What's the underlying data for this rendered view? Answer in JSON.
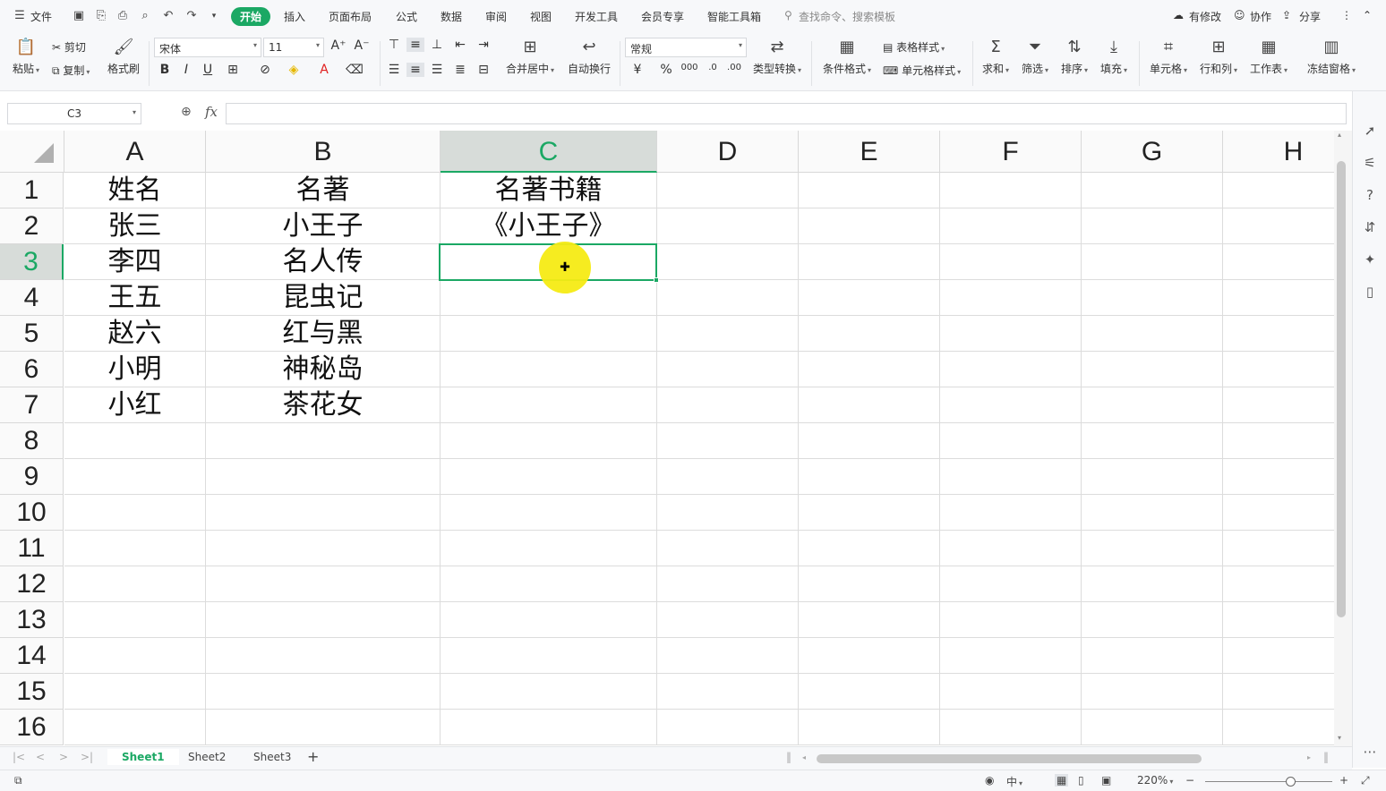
{
  "menubar": {
    "file_label": "文件",
    "tabs": [
      "开始",
      "插入",
      "页面布局",
      "公式",
      "数据",
      "审阅",
      "视图",
      "开发工具",
      "会员专享",
      "智能工具箱"
    ],
    "search_placeholder": "查找命令、搜索模板",
    "modified_label": "有修改",
    "collab_label": "协作",
    "share_label": "分享"
  },
  "ribbon": {
    "paste": "粘贴",
    "cut": "剪切",
    "copy": "复制",
    "format_painter": "格式刷",
    "font_name": "宋体",
    "font_size": "11",
    "merge_center": "合并居中",
    "wrap_text": "自动换行",
    "number_format": "常规",
    "type_convert": "类型转换",
    "conditional_format": "条件格式",
    "table_style": "表格样式",
    "cell_style": "单元格样式",
    "sum": "求和",
    "filter": "筛选",
    "sort": "排序",
    "fill": "填充",
    "cell": "单元格",
    "row_col": "行和列",
    "worksheet": "工作表",
    "freeze": "冻结窗格"
  },
  "formula_bar": {
    "name_box": "C3",
    "fx_label": "fx",
    "formula": ""
  },
  "sheet": {
    "columns": [
      "A",
      "B",
      "C",
      "D",
      "E",
      "F",
      "G",
      "H"
    ],
    "rows": [
      "1",
      "2",
      "3",
      "4",
      "5",
      "6",
      "7",
      "8",
      "9",
      "10",
      "11",
      "12",
      "13",
      "14",
      "15",
      "16"
    ],
    "cells": [
      [
        "姓名",
        "名著",
        "名著书籍"
      ],
      [
        "张三",
        "小王子",
        "《小王子》"
      ],
      [
        "李四",
        "名人传",
        ""
      ],
      [
        "王五",
        "昆虫记",
        ""
      ],
      [
        "赵六",
        "红与黑",
        ""
      ],
      [
        "小明",
        "神秘岛",
        ""
      ],
      [
        "小红",
        "茶花女",
        ""
      ]
    ],
    "selected_cell": "C3"
  },
  "sheet_tabs": [
    "Sheet1",
    "Sheet2",
    "Sheet3"
  ],
  "status": {
    "zoom": "220%"
  },
  "colors": {
    "accent": "#1ba864",
    "highlight": "#f5eb14"
  }
}
